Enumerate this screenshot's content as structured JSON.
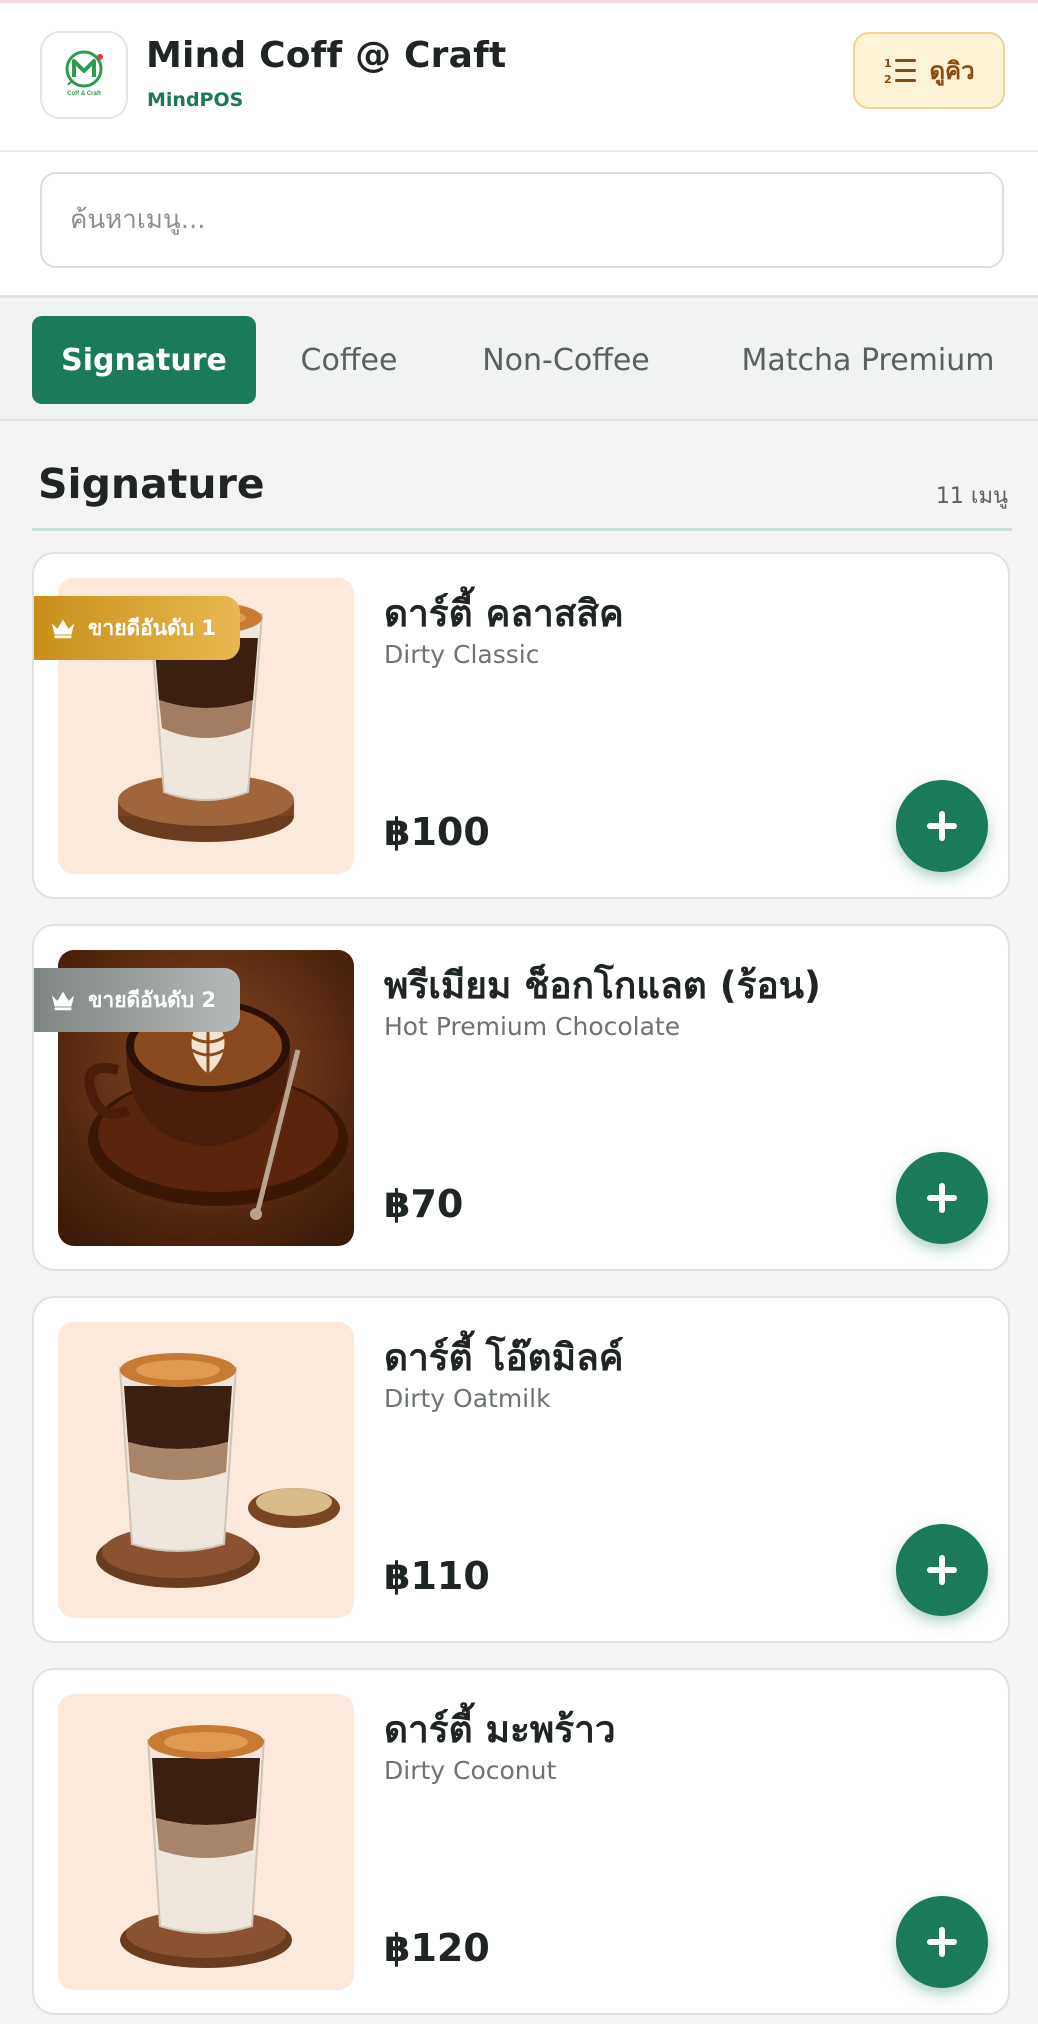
{
  "header": {
    "brand_name": "Mind Coff @ Craft",
    "brand_sub": "MindPOS",
    "queue_label": "ดูคิว",
    "logo_text": "Coff & Craft"
  },
  "search": {
    "placeholder": "ค้นหาเมนู..."
  },
  "tabs": [
    {
      "label": "Signature",
      "active": true
    },
    {
      "label": "Coffee",
      "active": false
    },
    {
      "label": "Non-Coffee",
      "active": false
    },
    {
      "label": "Matcha Premium",
      "active": false
    }
  ],
  "section": {
    "title": "Signature",
    "count": "11 เมนู"
  },
  "items": [
    {
      "name": "ดาร์ตี้ คลาสสิค",
      "sub": "Dirty Classic",
      "price": "฿100",
      "badge": "ขายดีอันดับ 1"
    },
    {
      "name": "พรีเมียม ช็อกโกแลต (ร้อน)",
      "sub": "Hot Premium Chocolate",
      "price": "฿70",
      "badge": "ขายดีอันดับ 2"
    },
    {
      "name": "ดาร์ตี้ โอ๊ตมิลค์",
      "sub": "Dirty Oatmilk",
      "price": "฿110"
    },
    {
      "name": "ดาร์ตี้ มะพร้าว",
      "sub": "Dirty Coconut",
      "price": "฿120"
    }
  ],
  "colors": {
    "accent": "#1b7a5c",
    "gold_badge": "#c8901a",
    "silver_badge": "#7e8583",
    "queue_bg": "#fff3d6"
  }
}
